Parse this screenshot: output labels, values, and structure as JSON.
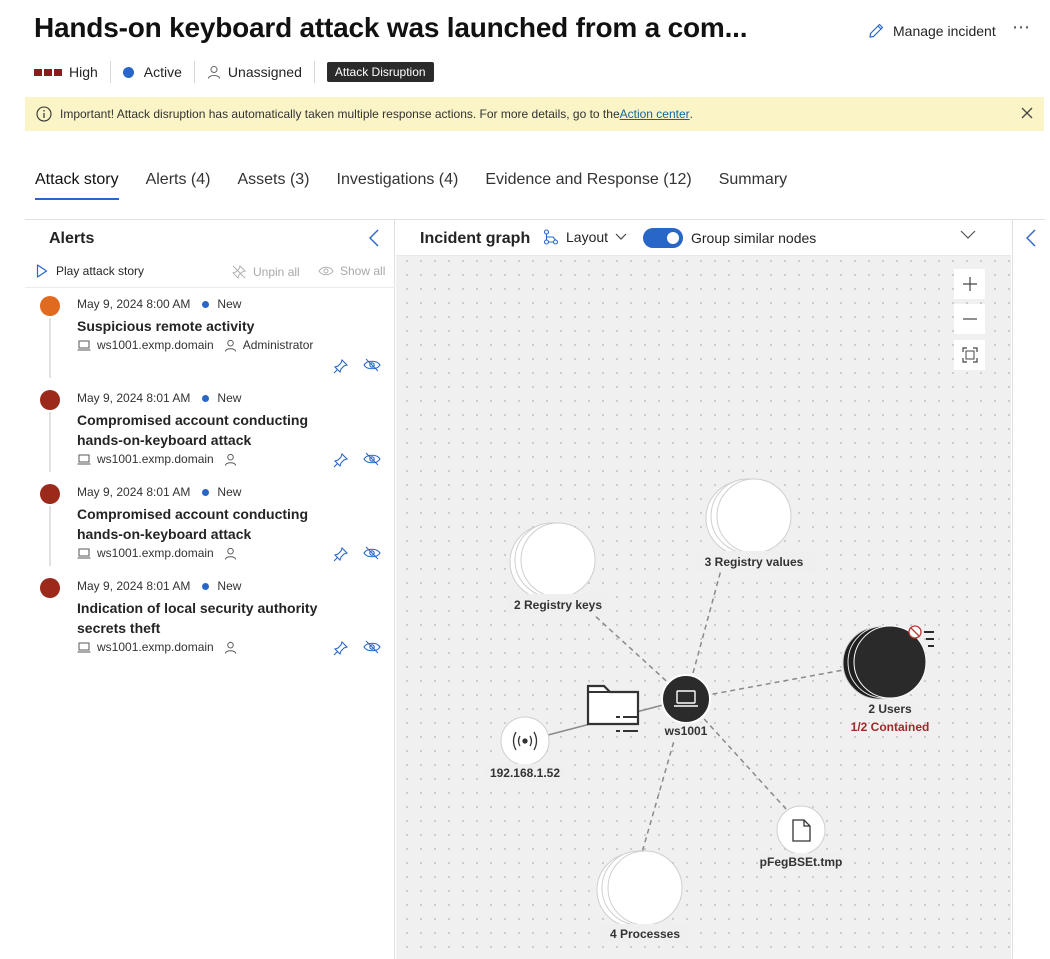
{
  "header": {
    "title": "Hands-on keyboard attack was launched from a com...",
    "manage_label": "Manage incident",
    "more_label": "⋯",
    "severity": "High",
    "status": "Active",
    "assignee": "Unassigned",
    "tag": "Attack Disruption"
  },
  "banner": {
    "text": "Important! Attack disruption has automatically taken multiple response actions. For more details, go to the ",
    "link": "Action center",
    "suffix": "."
  },
  "tabs": [
    {
      "label": "Attack story"
    },
    {
      "label": "Alerts (4)"
    },
    {
      "label": "Assets (3)"
    },
    {
      "label": "Investigations (4)"
    },
    {
      "label": "Evidence and Response (12)"
    },
    {
      "label": "Summary"
    }
  ],
  "alerts_panel": {
    "title": "Alerts",
    "play_label": "Play attack story",
    "unpin_label": "Unpin all",
    "show_label": "Show all",
    "items": [
      {
        "date": "May 9, 2024 8:00 AM",
        "status": "New",
        "name": "Suspicious remote activity",
        "device": "ws1001.exmp.domain",
        "user": "Administrator",
        "severity_color": "#e06a1f"
      },
      {
        "date": "May 9, 2024 8:01 AM",
        "status": "New",
        "name": "Compromised account conducting hands-on-keyboard attack",
        "device": "ws1001.exmp.domain",
        "user": "",
        "severity_color": "#9b2a1b"
      },
      {
        "date": "May 9, 2024 8:01 AM",
        "status": "New",
        "name": "Compromised account conducting hands-on-keyboard attack",
        "device": "ws1001.exmp.domain",
        "user": "",
        "severity_color": "#9b2a1b"
      },
      {
        "date": "May 9, 2024 8:01 AM",
        "status": "New",
        "name": "Indication of local security authority secrets theft",
        "device": "ws1001.exmp.domain",
        "user": "",
        "severity_color": "#9b2a1b"
      }
    ]
  },
  "graph": {
    "title": "Incident graph",
    "layout_label": "Layout",
    "group_label": "Group similar nodes",
    "group_enabled": true,
    "nodes": {
      "device": "ws1001",
      "registry_keys": "2 Registry keys",
      "registry_values": "3 Registry values",
      "users": "2 Users",
      "users_status": "1/2 Contained",
      "ip": "192.168.1.52",
      "file": "pFegBSEt.tmp",
      "processes": "4 Processes"
    }
  }
}
